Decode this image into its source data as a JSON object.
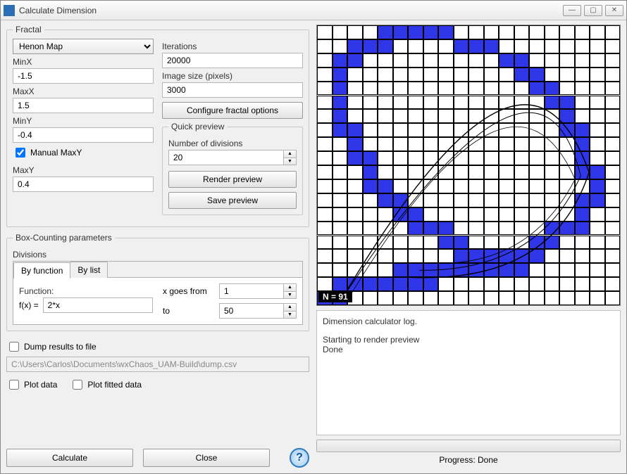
{
  "window": {
    "title": "Calculate Dimension"
  },
  "fractal": {
    "legend": "Fractal",
    "type_options": [
      "Henon Map"
    ],
    "type_selected": "Henon Map",
    "minx_label": "MinX",
    "minx_value": "-1.5",
    "maxx_label": "MaxX",
    "maxx_value": "1.5",
    "miny_label": "MinY",
    "miny_value": "-0.4",
    "manual_maxy_label": "Manual MaxY",
    "manual_maxy_checked": true,
    "maxy_label": "MaxY",
    "maxy_value": "0.4",
    "iterations_label": "Iterations",
    "iterations_value": "20000",
    "imgsize_label": "Image size (pixels)",
    "imgsize_value": "3000",
    "configure_btn": "Configure fractal options",
    "quick_preview_legend": "Quick preview",
    "num_div_label": "Number of divisions",
    "num_div_value": "20",
    "render_btn": "Render preview",
    "save_btn": "Save preview"
  },
  "boxcount": {
    "legend": "Box-Counting parameters",
    "divisions_label": "Divisions",
    "tab_by_function": "By function",
    "tab_by_list": "By list",
    "function_label": "Function:",
    "fx_label": "f(x)  =",
    "fx_value": "2*x",
    "x_from_label": "x goes from",
    "x_from_value": "1",
    "x_to_label": "to",
    "x_to_value": "50"
  },
  "dump": {
    "dump_label": "Dump results to file",
    "dump_checked": false,
    "path": "C:\\Users\\Carlos\\Documents\\wxChaos_UAM-Build\\dump.csv",
    "plot_data_label": "Plot data",
    "plot_data_checked": false,
    "plot_fitted_label": "Plot fitted data",
    "plot_fitted_checked": false
  },
  "actions": {
    "calculate": "Calculate",
    "close": "Close"
  },
  "preview": {
    "n_label": "N = 91",
    "grid_size": 20,
    "filled_cells": [
      [
        4,
        0
      ],
      [
        5,
        0
      ],
      [
        6,
        0
      ],
      [
        7,
        0
      ],
      [
        8,
        0
      ],
      [
        2,
        1
      ],
      [
        3,
        1
      ],
      [
        4,
        1
      ],
      [
        9,
        1
      ],
      [
        10,
        1
      ],
      [
        11,
        1
      ],
      [
        1,
        2
      ],
      [
        2,
        2
      ],
      [
        12,
        2
      ],
      [
        13,
        2
      ],
      [
        1,
        3
      ],
      [
        13,
        3
      ],
      [
        14,
        3
      ],
      [
        1,
        4
      ],
      [
        14,
        4
      ],
      [
        15,
        4
      ],
      [
        1,
        5
      ],
      [
        15,
        5
      ],
      [
        16,
        5
      ],
      [
        1,
        6
      ],
      [
        16,
        6
      ],
      [
        1,
        7
      ],
      [
        2,
        7
      ],
      [
        16,
        7
      ],
      [
        17,
        7
      ],
      [
        2,
        8
      ],
      [
        17,
        8
      ],
      [
        2,
        9
      ],
      [
        3,
        9
      ],
      [
        17,
        9
      ],
      [
        3,
        10
      ],
      [
        17,
        10
      ],
      [
        18,
        10
      ],
      [
        3,
        11
      ],
      [
        4,
        11
      ],
      [
        18,
        11
      ],
      [
        4,
        12
      ],
      [
        5,
        12
      ],
      [
        17,
        12
      ],
      [
        18,
        12
      ],
      [
        5,
        13
      ],
      [
        6,
        13
      ],
      [
        17,
        13
      ],
      [
        6,
        14
      ],
      [
        7,
        14
      ],
      [
        8,
        14
      ],
      [
        15,
        14
      ],
      [
        16,
        14
      ],
      [
        17,
        14
      ],
      [
        8,
        15
      ],
      [
        9,
        15
      ],
      [
        14,
        15
      ],
      [
        15,
        15
      ],
      [
        9,
        16
      ],
      [
        10,
        16
      ],
      [
        11,
        16
      ],
      [
        12,
        16
      ],
      [
        13,
        16
      ],
      [
        14,
        16
      ],
      [
        5,
        17
      ],
      [
        6,
        17
      ],
      [
        7,
        17
      ],
      [
        8,
        17
      ],
      [
        9,
        17
      ],
      [
        10,
        17
      ],
      [
        11,
        17
      ],
      [
        12,
        17
      ],
      [
        13,
        17
      ],
      [
        1,
        18
      ],
      [
        2,
        18
      ],
      [
        3,
        18
      ],
      [
        4,
        18
      ],
      [
        5,
        18
      ],
      [
        6,
        18
      ],
      [
        7,
        18
      ],
      [
        0,
        19
      ],
      [
        1,
        19
      ]
    ]
  },
  "log": {
    "header": "Dimension calculator log.",
    "lines": [
      "Starting to render preview",
      "Done"
    ]
  },
  "progress": {
    "label": "Progress: Done"
  }
}
